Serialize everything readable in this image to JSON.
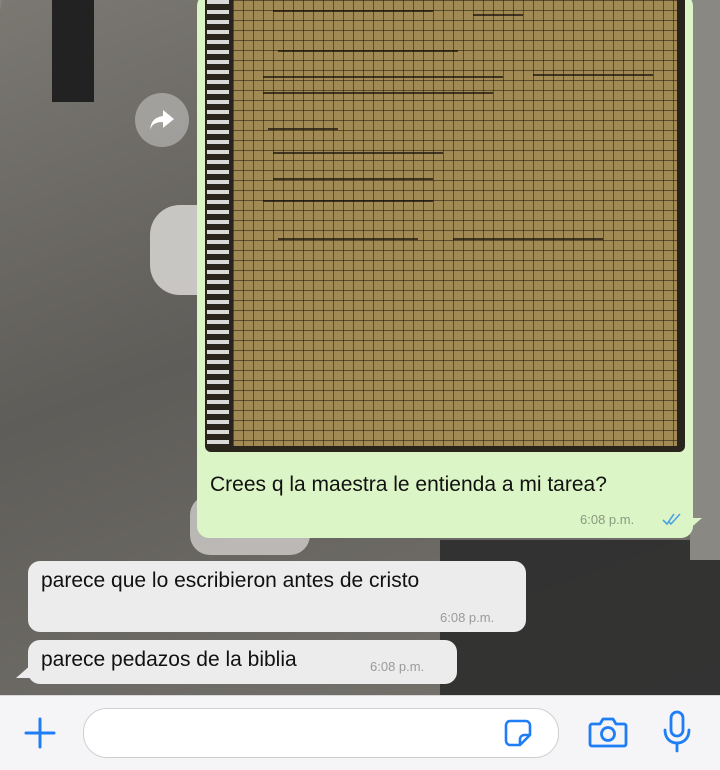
{
  "chat": {
    "messages": [
      {
        "direction": "outgoing",
        "type": "image",
        "text": "Crees q la maestra le entienda a mi tarea?",
        "time": "6:08 p.m.",
        "status": "read-double-check"
      },
      {
        "direction": "incoming",
        "text": "parece que lo escribieron antes de cristo",
        "time": "6:08 p.m."
      },
      {
        "direction": "incoming",
        "text": "parece pedazos de la biblia",
        "time": "6:08 p.m."
      }
    ]
  },
  "input_bar": {
    "message_value": "",
    "icons": [
      "plus-icon",
      "sticker-icon",
      "camera-icon",
      "microphone-icon"
    ],
    "accent": "#1f7ef6"
  },
  "colors": {
    "outgoing_bubble": "#dcf5c6",
    "incoming_bubble": "#ececec",
    "read_ticks": "#4aa3e8"
  }
}
